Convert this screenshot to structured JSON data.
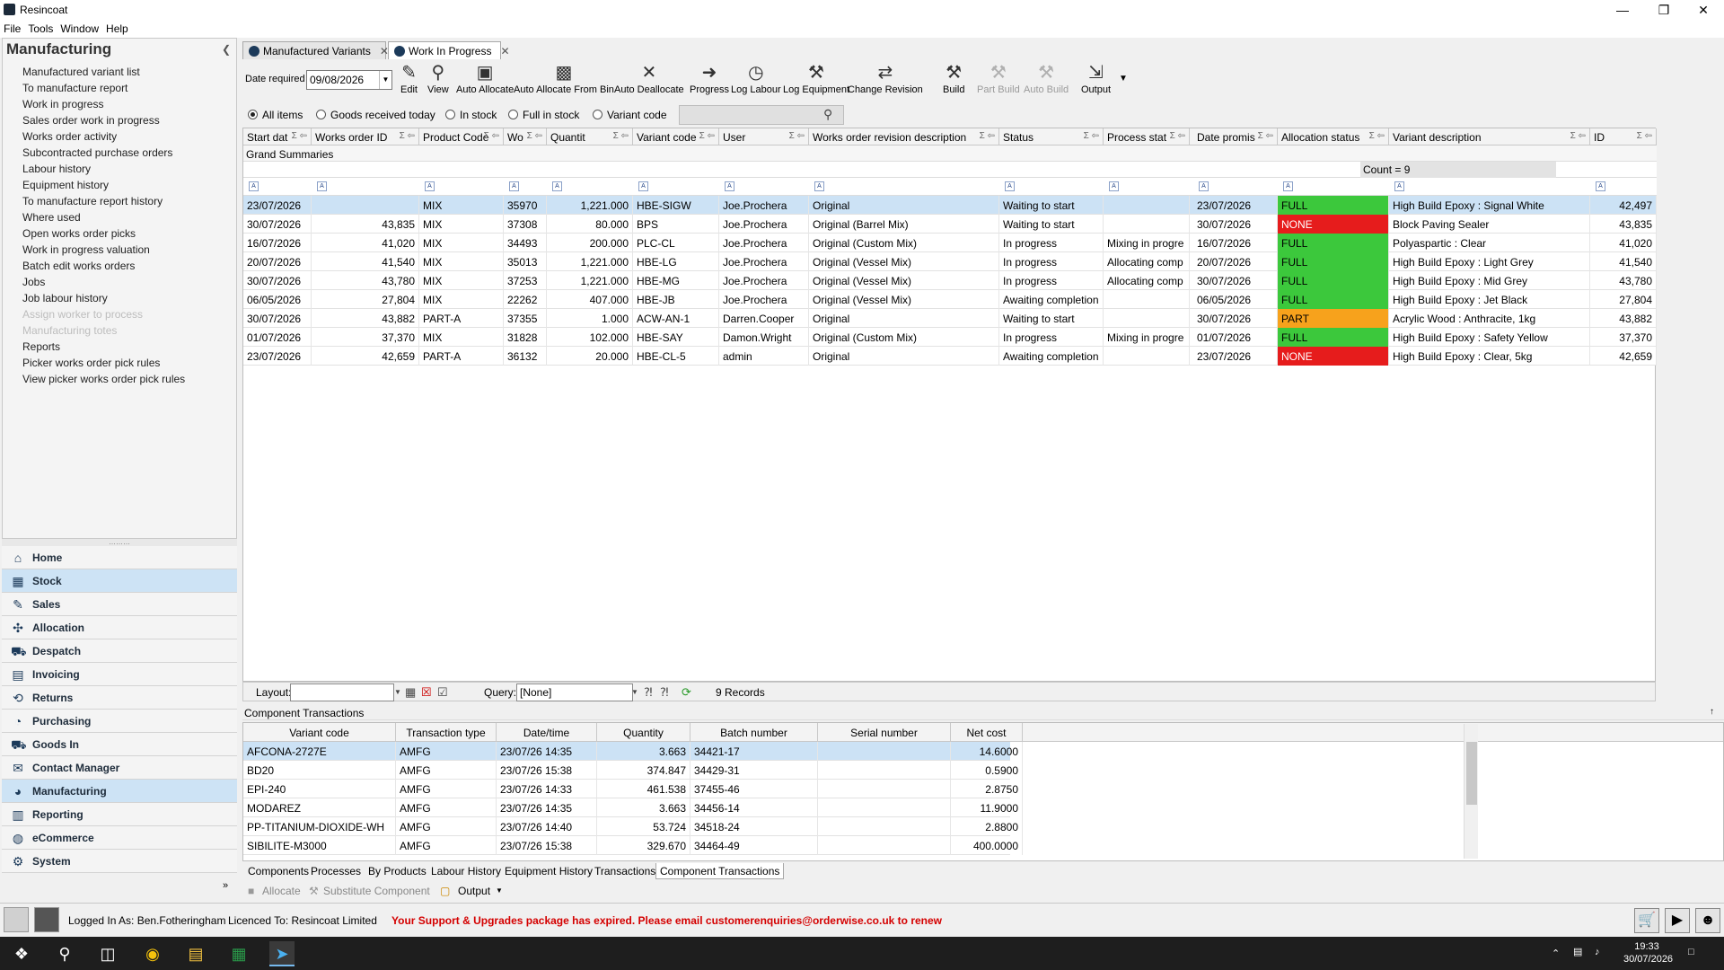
{
  "app": {
    "title": "Resincoat"
  },
  "menu": [
    "File",
    "Tools",
    "Window",
    "Help"
  ],
  "left_panel": {
    "title": "Manufacturing",
    "items": [
      {
        "label": "Manufactured variant list",
        "enabled": true
      },
      {
        "label": "To manufacture report",
        "enabled": true
      },
      {
        "label": "Work in progress",
        "enabled": true
      },
      {
        "label": "Sales order work in progress",
        "enabled": true
      },
      {
        "label": "Works order activity",
        "enabled": true
      },
      {
        "label": "Subcontracted purchase orders",
        "enabled": true
      },
      {
        "label": "Labour history",
        "enabled": true
      },
      {
        "label": "Equipment history",
        "enabled": true
      },
      {
        "label": "To manufacture report history",
        "enabled": true
      },
      {
        "label": "Where used",
        "enabled": true
      },
      {
        "label": "Open works order picks",
        "enabled": true
      },
      {
        "label": "Work in progress valuation",
        "enabled": true
      },
      {
        "label": "Batch edit works orders",
        "enabled": true
      },
      {
        "label": "Jobs",
        "enabled": true
      },
      {
        "label": "Job labour history",
        "enabled": true
      },
      {
        "label": "Assign worker to process",
        "enabled": false
      },
      {
        "label": "Manufacturing totes",
        "enabled": false
      },
      {
        "label": "Reports",
        "enabled": true
      },
      {
        "label": "Picker works order pick rules",
        "enabled": true
      },
      {
        "label": "View picker works order pick rules",
        "enabled": true
      }
    ]
  },
  "nav": [
    {
      "label": "Home",
      "icon": "home-icon",
      "glyph": "⌂",
      "selected": false
    },
    {
      "label": "Stock",
      "icon": "stock-icon",
      "glyph": "▦",
      "selected": true
    },
    {
      "label": "Sales",
      "icon": "sales-icon",
      "glyph": "✎",
      "selected": false
    },
    {
      "label": "Allocation",
      "icon": "allocation-icon",
      "glyph": "✣",
      "selected": false
    },
    {
      "label": "Despatch",
      "icon": "despatch-icon",
      "glyph": "⛟",
      "selected": false
    },
    {
      "label": "Invoicing",
      "icon": "invoicing-icon",
      "glyph": "▤",
      "selected": false
    },
    {
      "label": "Returns",
      "icon": "returns-icon",
      "glyph": "⟲",
      "selected": false
    },
    {
      "label": "Purchasing",
      "icon": "purchasing-icon",
      "glyph": "◔",
      "selected": false
    },
    {
      "label": "Goods In",
      "icon": "goods-in-icon",
      "glyph": "⛟",
      "selected": false
    },
    {
      "label": "Contact Manager",
      "icon": "contact-manager-icon",
      "glyph": "✉",
      "selected": false
    },
    {
      "label": "Manufacturing",
      "icon": "manufacturing-icon",
      "glyph": "◕",
      "selected": true
    },
    {
      "label": "Reporting",
      "icon": "reporting-icon",
      "glyph": "▥",
      "selected": false
    },
    {
      "label": "eCommerce",
      "icon": "ecommerce-icon",
      "glyph": "◍",
      "selected": false
    },
    {
      "label": "System",
      "icon": "system-icon",
      "glyph": "⚙",
      "selected": false
    }
  ],
  "tabs": [
    {
      "label": "Manufactured Variants",
      "active": false
    },
    {
      "label": "Work In Progress",
      "active": true
    }
  ],
  "toolbar": {
    "date_label": "Date required",
    "date_value": "09/08/2026",
    "buttons": [
      {
        "label": "Edit",
        "icon": "pencil-icon",
        "glyph": "✎",
        "enabled": true
      },
      {
        "label": "View",
        "icon": "magnifier-icon",
        "glyph": "⚲",
        "enabled": true
      },
      {
        "label": "Auto Allocate",
        "icon": "auto-allocate-icon",
        "glyph": "▣",
        "enabled": true
      },
      {
        "label": "Auto Allocate From Bin",
        "icon": "bin-icon",
        "glyph": "▩",
        "enabled": true
      },
      {
        "label": "Auto Deallocate",
        "icon": "deallocate-icon",
        "glyph": "✕",
        "enabled": true
      },
      {
        "label": "Progress",
        "icon": "progress-icon",
        "glyph": "➜",
        "enabled": true
      },
      {
        "label": "Log Labour",
        "icon": "clock-icon",
        "glyph": "◷",
        "enabled": true
      },
      {
        "label": "Log Equipment",
        "icon": "equipment-icon",
        "glyph": "⚒",
        "enabled": true
      },
      {
        "label": "Change Revision",
        "icon": "revision-icon",
        "glyph": "⇄",
        "enabled": true
      },
      {
        "label": "Build",
        "icon": "build-icon",
        "glyph": "⚒",
        "enabled": true
      },
      {
        "label": "Part Build",
        "icon": "part-build-icon",
        "glyph": "⚒",
        "enabled": false
      },
      {
        "label": "Auto Build",
        "icon": "auto-build-icon",
        "glyph": "⚒",
        "enabled": false
      },
      {
        "label": "Output",
        "icon": "output-icon",
        "glyph": "⇲",
        "enabled": true
      }
    ]
  },
  "filters": [
    {
      "label": "All items",
      "checked": true
    },
    {
      "label": "Goods received today",
      "checked": false
    },
    {
      "label": "In stock",
      "checked": false
    },
    {
      "label": "Full in stock",
      "checked": false
    },
    {
      "label": "Variant code",
      "checked": false
    }
  ],
  "grid": {
    "columns": [
      "Start dat",
      "Works order ID",
      "Product Code",
      "Wo",
      "Quantit",
      "Variant code",
      "User",
      "Works order revision description",
      "Status",
      "Process stat",
      "Date promis",
      "Allocation status",
      "Variant description",
      "ID"
    ],
    "grand_summaries_label": "Grand Summaries",
    "count_label": "Count = 9",
    "rows": [
      [
        "23/07/2026",
        "",
        "MIX",
        "35970",
        "1,221.000",
        "HBE-SIGW",
        "Joe.Prochera",
        "Original",
        "Waiting to start",
        "",
        "23/07/2026",
        "FULL",
        "High Build Epoxy : Signal White",
        "42,497"
      ],
      [
        "30/07/2026",
        "43,835",
        "MIX",
        "37308",
        "80.000",
        "BPS",
        "Joe.Prochera",
        "Original (Barrel Mix)",
        "Waiting to start",
        "",
        "30/07/2026",
        "NONE",
        "Block Paving Sealer",
        "43,835"
      ],
      [
        "16/07/2026",
        "41,020",
        "MIX",
        "34493",
        "200.000",
        "PLC-CL",
        "Joe.Prochera",
        "Original (Custom Mix)",
        "In progress",
        "Mixing in progre",
        "16/07/2026",
        "FULL",
        "Polyaspartic : Clear",
        "41,020"
      ],
      [
        "20/07/2026",
        "41,540",
        "MIX",
        "35013",
        "1,221.000",
        "HBE-LG",
        "Joe.Prochera",
        "Original (Vessel Mix)",
        "In progress",
        "Allocating comp",
        "20/07/2026",
        "FULL",
        "High Build Epoxy : Light Grey",
        "41,540"
      ],
      [
        "30/07/2026",
        "43,780",
        "MIX",
        "37253",
        "1,221.000",
        "HBE-MG",
        "Joe.Prochera",
        "Original (Vessel Mix)",
        "In progress",
        "Allocating comp",
        "30/07/2026",
        "FULL",
        "High Build Epoxy : Mid Grey",
        "43,780"
      ],
      [
        "06/05/2026",
        "27,804",
        "MIX",
        "22262",
        "407.000",
        "HBE-JB",
        "Joe.Prochera",
        "Original (Vessel Mix)",
        "Awaiting completion",
        "",
        "06/05/2026",
        "FULL",
        "High Build Epoxy : Jet Black",
        "27,804"
      ],
      [
        "30/07/2026",
        "43,882",
        "PART-A",
        "37355",
        "1.000",
        "ACW-AN-1",
        "Darren.Cooper",
        "Original",
        "Waiting to start",
        "",
        "30/07/2026",
        "PART",
        "Acrylic Wood : Anthracite, 1kg",
        "43,882"
      ],
      [
        "01/07/2026",
        "37,370",
        "MIX",
        "31828",
        "102.000",
        "HBE-SAY",
        "Damon.Wright",
        "Original (Custom Mix)",
        "In progress",
        "Mixing in progre",
        "01/07/2026",
        "FULL",
        "High Build Epoxy : Safety Yellow",
        "37,370"
      ],
      [
        "23/07/2026",
        "42,659",
        "PART-A",
        "36132",
        "20.000",
        "HBE-CL-5",
        "admin",
        "Original",
        "Awaiting completion",
        "",
        "23/07/2026",
        "NONE",
        "High Build Epoxy : Clear, 5kg",
        "42,659"
      ]
    ]
  },
  "grid_footer": {
    "layout_label": "Layout:",
    "layout_value": "",
    "query_label": "Query:",
    "query_value": "[None]",
    "records": "9 Records"
  },
  "component_transactions": {
    "title": "Component Transactions",
    "columns": [
      "Variant code",
      "Transaction type",
      "Date/time",
      "Quantity",
      "Batch number",
      "Serial number",
      "Net cost"
    ],
    "rows": [
      [
        "AFCONA-2727E",
        "AMFG",
        "23/07/26 14:35",
        "3.663",
        "34421-17",
        "",
        "14.6000"
      ],
      [
        "BD20",
        "AMFG",
        "23/07/26 15:38",
        "374.847",
        "34429-31",
        "",
        "0.5900"
      ],
      [
        "EPI-240",
        "AMFG",
        "23/07/26 14:33",
        "461.538",
        "37455-46",
        "",
        "2.8750"
      ],
      [
        "MODAREZ",
        "AMFG",
        "23/07/26 14:35",
        "3.663",
        "34456-14",
        "",
        "11.9000"
      ],
      [
        "PP-TITANIUM-DIOXIDE-WH",
        "AMFG",
        "23/07/26 14:40",
        "53.724",
        "34518-24",
        "",
        "2.8800"
      ],
      [
        "SIBILITE-M3000",
        "AMFG",
        "23/07/26 15:38",
        "329.670",
        "34464-49",
        "",
        "400.0000"
      ]
    ]
  },
  "bottom_tabs": [
    {
      "label": "Components",
      "active": false
    },
    {
      "label": "Processes",
      "active": false
    },
    {
      "label": "By Products",
      "active": false
    },
    {
      "label": "Labour History",
      "active": false
    },
    {
      "label": "Equipment History",
      "active": false
    },
    {
      "label": "Transactions",
      "active": false
    },
    {
      "label": "Component Transactions",
      "active": true
    }
  ],
  "bottom_actions": {
    "allocate": "Allocate",
    "substitute": "Substitute Component",
    "output": "Output"
  },
  "status": {
    "logged_in": "Logged In As: Ben.Fotheringham",
    "licenced": "Licenced To: Resincoat Limited",
    "warning": "Your Support & Upgrades package has expired. Please email customerenquiries@orderwise.co.uk to renew"
  },
  "taskbar": {
    "time": "19:33",
    "date": "30/07/2026"
  },
  "colors": {
    "full": "#3cc83c",
    "none": "#e61c1c",
    "part": "#f7a21c",
    "selected_row": "#cce2f5"
  }
}
